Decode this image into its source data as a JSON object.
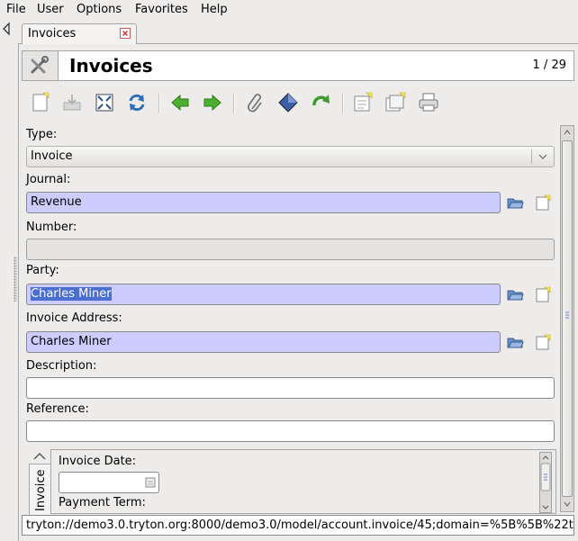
{
  "menu": {
    "file": "File",
    "user": "User",
    "options": "Options",
    "favorites": "Favorites",
    "help": "Help"
  },
  "tab": {
    "label": "Invoices"
  },
  "header": {
    "title": "Invoices",
    "record_count": "1 / 29"
  },
  "toolbar": [
    "new-icon",
    "save-icon",
    "switch-view-icon",
    "reload-icon",
    "previous-icon",
    "next-icon",
    "attachment-icon",
    "action-icon",
    "relate-icon",
    "new-record-icon",
    "open-record-icon",
    "print-icon"
  ],
  "form": {
    "type_label": "Type:",
    "type_value": "Invoice",
    "journal_label": "Journal:",
    "journal_value": "Revenue",
    "number_label": "Number:",
    "number_value": "",
    "party_label": "Party:",
    "party_value": "Charles Miner",
    "invoice_address_label": "Invoice Address:",
    "invoice_address_value": "Charles Miner",
    "description_label": "Description:",
    "description_value": "",
    "reference_label": "Reference:",
    "reference_value": "",
    "notebook_tab": "Invoice",
    "invoice_date_label": "Invoice Date:",
    "invoice_date_value": "",
    "payment_term_label": "Payment Term:"
  },
  "status": {
    "url": "tryton://demo3.0.tryton.org:8000/demo3.0/model/account.invoice/45;domain=%5B%5B%22t"
  },
  "colors": {
    "required_field": "#ccccff",
    "selection": "#4a6fd0",
    "background": "#edeceb"
  }
}
